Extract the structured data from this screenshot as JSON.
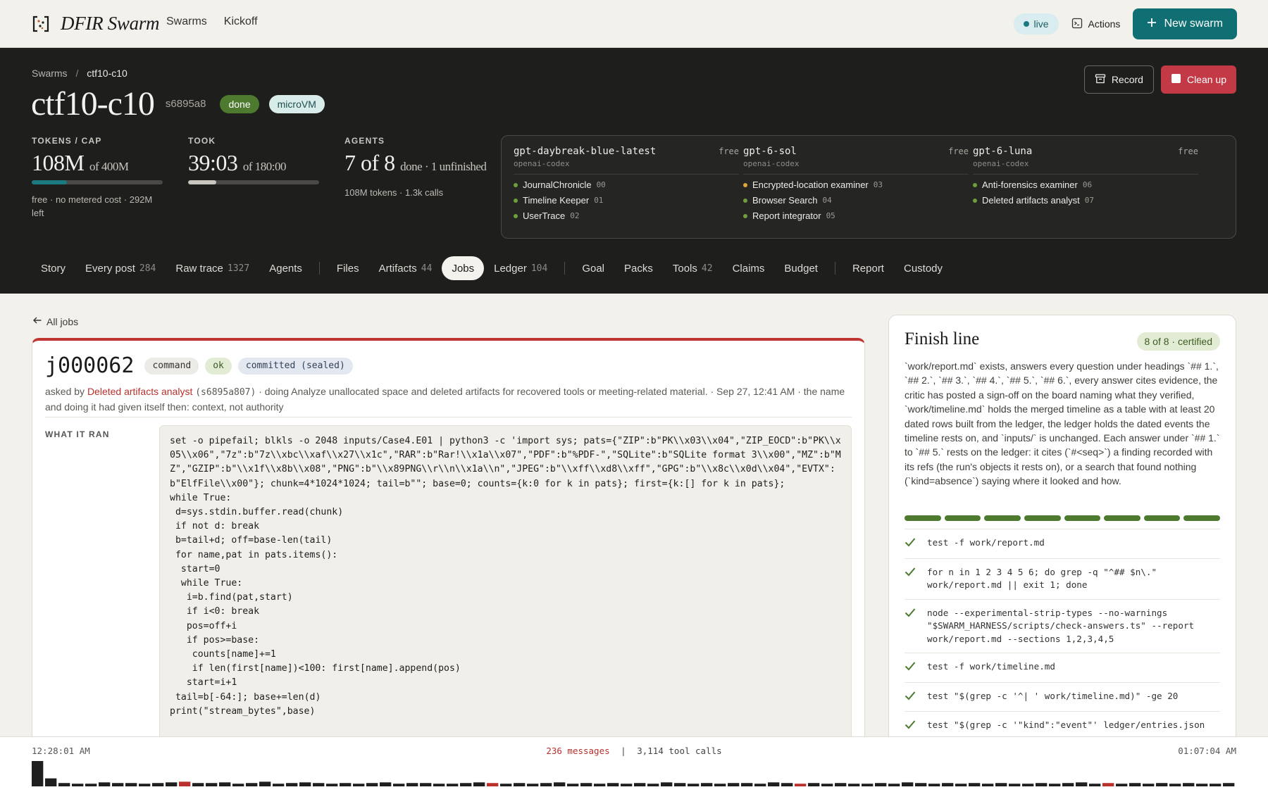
{
  "topbar": {
    "brand": "DFIR Swarm",
    "nav": [
      "Swarms",
      "Kickoff"
    ],
    "live": "live",
    "actions": "Actions",
    "new_swarm": "New swarm",
    "icons": {
      "brand": "bracket-logo-icon",
      "actions": "terminal-icon",
      "new": "plus-icon"
    }
  },
  "hero": {
    "breadcrumb": {
      "root": "Swarms",
      "sep": "/",
      "current": "ctf10-c10"
    },
    "title": "ctf10-c10",
    "hash": "s6895a8",
    "status": "done",
    "runtime": "microVM",
    "record": "Record",
    "cleanup": "Clean up",
    "stats": {
      "tokens": {
        "label": "TOKENS / CAP",
        "value": "108M",
        "of": "of 400M",
        "progress": 0.27,
        "note": "free · no metered cost · 292M left",
        "color": "#1b7a80"
      },
      "took": {
        "label": "TOOK",
        "value": "39:03",
        "of": "of 180:00",
        "progress": 0.217,
        "color": "#c9c6bf"
      },
      "agents": {
        "label": "AGENTS",
        "value": "7 of 8",
        "of": "done · 1 unfinished",
        "note": "108M tokens · 1.3k calls"
      }
    },
    "models": [
      {
        "name": "gpt-daybreak-blue-latest",
        "tier": "free",
        "provider": "openai-codex",
        "agents": [
          {
            "name": "JournalChronicle",
            "num": "00",
            "state": "done"
          },
          {
            "name": "Timeline Keeper",
            "num": "01",
            "state": "done"
          },
          {
            "name": "UserTrace",
            "num": "02",
            "state": "done"
          }
        ]
      },
      {
        "name": "gpt-6-sol",
        "tier": "free",
        "provider": "openai-codex",
        "agents": [
          {
            "name": "Encrypted-location examiner",
            "num": "03",
            "state": "unfinished"
          },
          {
            "name": "Browser Search",
            "num": "04",
            "state": "done"
          },
          {
            "name": "Report integrator",
            "num": "05",
            "state": "done"
          }
        ]
      },
      {
        "name": "gpt-6-luna",
        "tier": "free",
        "provider": "openai-codex",
        "agents": [
          {
            "name": "Anti-forensics examiner",
            "num": "06",
            "state": "done"
          },
          {
            "name": "Deleted artifacts analyst",
            "num": "07",
            "state": "done"
          }
        ]
      }
    ],
    "tabs": [
      {
        "label": "Story"
      },
      {
        "label": "Every post",
        "count": "284"
      },
      {
        "label": "Raw trace",
        "count": "1327"
      },
      {
        "label": "Agents"
      },
      {
        "sep": true
      },
      {
        "label": "Files"
      },
      {
        "label": "Artifacts",
        "count": "44"
      },
      {
        "label": "Jobs",
        "active": true
      },
      {
        "label": "Ledger",
        "count": "104"
      },
      {
        "sep": true
      },
      {
        "label": "Goal"
      },
      {
        "label": "Packs"
      },
      {
        "label": "Tools",
        "count": "42"
      },
      {
        "label": "Claims"
      },
      {
        "label": "Budget"
      },
      {
        "sep": true
      },
      {
        "label": "Report"
      },
      {
        "label": "Custody"
      }
    ]
  },
  "job": {
    "back": "All jobs",
    "id": "j000062",
    "kind": "command",
    "result": "ok",
    "state": "committed (sealed)",
    "meta": {
      "asked_by": "asked by",
      "agent": "Deleted artifacts analyst",
      "agent_hash": "(s6895a807)",
      "rest": "· doing Analyze unallocated space and deleted artifacts for recovered tools or meeting-related material. · Sep 27, 12:41 AM · the name and doing it had given itself then: context, not authority"
    },
    "ran_label": "WHAT IT RAN",
    "command": "set -o pipefail; blkls -o 2048 inputs/Case4.E01 | python3 -c 'import sys; pats={\"ZIP\":b\"PK\\\\x03\\\\x04\",\"ZIP_EOCD\":b\"PK\\\\x05\\\\x06\",\"7z\":b\"7z\\\\xbc\\\\xaf\\\\x27\\\\x1c\",\"RAR\":b\"Rar!\\\\x1a\\\\x07\",\"PDF\":b\"%PDF-\",\"SQLite\":b\"SQLite format 3\\\\x00\",\"MZ\":b\"MZ\",\"GZIP\":b\"\\\\x1f\\\\x8b\\\\x08\",\"PNG\":b\"\\\\x89PNG\\\\r\\\\n\\\\x1a\\\\n\",\"JPEG\":b\"\\\\xff\\\\xd8\\\\xff\",\"GPG\":b\"\\\\x8c\\\\x0d\\\\x04\",\"EVTX\":b\"ElfFile\\\\x00\"}; chunk=4*1024*1024; tail=b\"\"; base=0; counts={k:0 for k in pats}; first={k:[] for k in pats};\nwhile True:\n d=sys.stdin.buffer.read(chunk)\n if not d: break\n b=tail+d; off=base-len(tail)\n for name,pat in pats.items():\n  start=0\n  while True:\n   i=b.find(pat,start)\n   if i<0: break\n   pos=off+i\n   if pos>=base:\n    counts[name]+=1\n    if len(first[name])<100: first[name].append(pos)\n   start=i+1\n tail=b[-64:]; base+=len(d)\nprint(\"stream_bytes\",base)"
  },
  "finish": {
    "title": "Finish line",
    "certified": "8 of 8 · certified",
    "description": "`work/report.md` exists, answers every question under headings `## 1.`, `## 2.`, `## 3.`, `## 4.`, `## 5.`, `## 6.`, every answer cites evidence, the critic has posted a sign-off on the board naming what they verified, `work/timeline.md` holds the merged timeline as a table with at least 20 dated rows built from the ledger, the ledger holds the dated events the timeline rests on, and `inputs/` is unchanged. Each answer under `## 1.` to `## 5.` rests on the ledger: it cites (`#<seq>`) a finding recorded with its refs (the run's objects it rests on), or a search that found nothing (`kind=absence`) saying where it looked and how.",
    "segments": 8,
    "checks": [
      "test -f work/report.md",
      "for n in 1 2 3 4 5 6; do grep -q \"^## $n\\.\" work/report.md || exit 1; done",
      "node --experimental-strip-types --no-warnings \"$SWARM_HARNESS/scripts/check-answers.ts\" --report work/report.md --sections 1,2,3,4,5",
      "test -f work/timeline.md",
      "test \"$(grep -c '^| ' work/timeline.md)\" -ge 20",
      "test \"$(grep -c '\"kind\":\"event\"' ledger/entries.json"
    ]
  },
  "timeline": {
    "start": "12:28:01 AM",
    "end": "01:07:04 AM",
    "messages": "236 messages",
    "sep": "|",
    "tool_calls": "3,114 tool calls",
    "activity": [
      38,
      12,
      5,
      4,
      4,
      6,
      5,
      5,
      4,
      5,
      6,
      7,
      5,
      5,
      6,
      4,
      5,
      7,
      4,
      5,
      6,
      5,
      4,
      5,
      4,
      5,
      6,
      4,
      5,
      5,
      4,
      4,
      5,
      6,
      5,
      4,
      5,
      4,
      5,
      6,
      4,
      5,
      4,
      5,
      4,
      5,
      4,
      6,
      5,
      4,
      5,
      4,
      5,
      5,
      4,
      6,
      5,
      4,
      5,
      4,
      5,
      4,
      4,
      5,
      4,
      6,
      5,
      4,
      5,
      4,
      5,
      4,
      5,
      4,
      4,
      5,
      4,
      5,
      6,
      4,
      5,
      4,
      5,
      4,
      5,
      4,
      5,
      4,
      4,
      5
    ]
  },
  "colors": {
    "accent": "#0f6f72",
    "danger": "#c33a46",
    "ok": "#4e7a2f",
    "msgs": "#b9302c"
  }
}
